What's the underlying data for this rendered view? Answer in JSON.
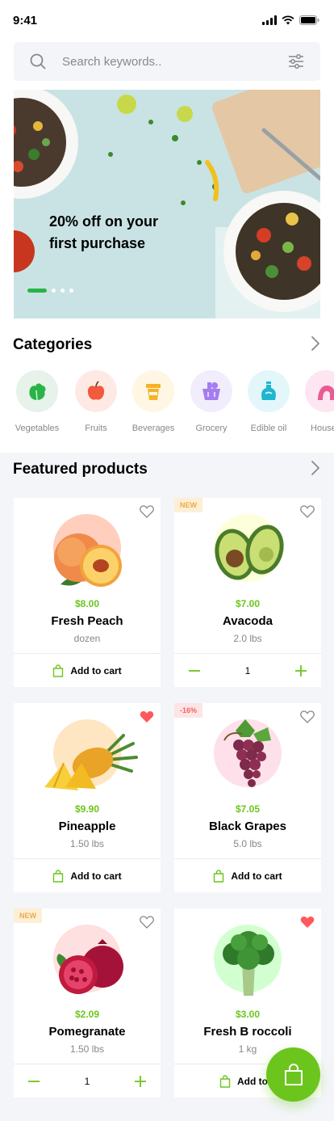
{
  "status_bar": {
    "time": "9:41"
  },
  "search": {
    "placeholder": "Search keywords.."
  },
  "hero": {
    "headline": "20% off on your first purchase",
    "slides": 4,
    "active_slide": 1
  },
  "categories": {
    "title": "Categories",
    "items": [
      {
        "label": "Vegetables",
        "icon": "lettuce-icon",
        "bg": "#e6f2ea",
        "color": "#28b446"
      },
      {
        "label": "Fruits",
        "icon": "apple-icon",
        "bg": "#ffe9e5",
        "color": "#f15a3a"
      },
      {
        "label": "Beverages",
        "icon": "cup-icon",
        "bg": "#fff6e3",
        "color": "#f5b326"
      },
      {
        "label": "Grocery",
        "icon": "basket-icon",
        "bg": "#f1edfc",
        "color": "#a67cf1"
      },
      {
        "label": "Edible oil",
        "icon": "oil-bottle-icon",
        "bg": "#e3f7fb",
        "color": "#1fb6cf"
      },
      {
        "label": "Househ",
        "icon": "household-icon",
        "bg": "#fde6f1",
        "color": "#e95c95"
      }
    ]
  },
  "featured": {
    "title": "Featured products",
    "products": [
      {
        "name": "Fresh Peach",
        "price": "$8.00",
        "unit": "dozen",
        "badge": "",
        "favorite": false,
        "action": "cart",
        "cart_label": "Add to cart",
        "circle": "#ffcebd",
        "icon": "peach-icon"
      },
      {
        "name": "Avacoda",
        "price": "$7.00",
        "unit": "2.0 lbs",
        "badge": "NEW",
        "favorite": false,
        "action": "stepper",
        "qty": "1",
        "circle": "#fcffd9",
        "icon": "avocado-icon"
      },
      {
        "name": "Pineapple",
        "price": "$9.90",
        "unit": "1.50 lbs",
        "badge": "",
        "favorite": true,
        "action": "cart",
        "cart_label": "Add to cart",
        "circle": "#ffe6c2",
        "icon": "pineapple-icon"
      },
      {
        "name": "Black Grapes",
        "price": "$7.05",
        "unit": "5.0 lbs",
        "badge": "-16%",
        "favorite": false,
        "action": "cart",
        "cart_label": "Add to cart",
        "circle": "#fee0ea",
        "icon": "grapes-icon"
      },
      {
        "name": "Pomegranate",
        "price": "$2.09",
        "unit": "1.50 lbs",
        "badge": "NEW",
        "favorite": false,
        "action": "stepper",
        "qty": "1",
        "circle": "#fee0e0",
        "icon": "pomegranate-icon"
      },
      {
        "name": "Fresh B roccoli",
        "price": "$3.00",
        "unit": "1 kg",
        "badge": "",
        "favorite": true,
        "action": "cart",
        "cart_label": "Add to c",
        "circle": "#d2ffd0",
        "icon": "broccoli-icon"
      }
    ]
  },
  "colors": {
    "accent": "#6cc51d",
    "favorite": "#fe585a",
    "muted": "#868889"
  }
}
